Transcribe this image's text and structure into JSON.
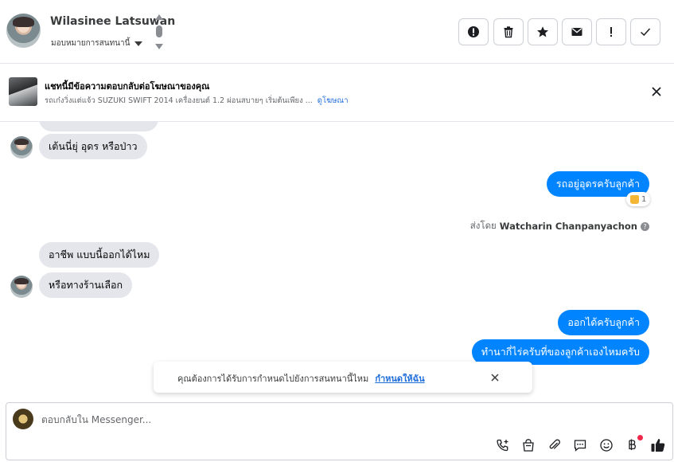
{
  "header": {
    "name": "Wilasinee Latsuwan",
    "assign_label": "มอบหมายการสนทนานี้"
  },
  "toolbar": {
    "buttons": [
      "report-icon",
      "trash-icon",
      "star-icon",
      "mail-icon",
      "exclamation-icon",
      "check-icon"
    ]
  },
  "ad": {
    "title": "แชทนี้มีข้อความตอบกลับต่อโฆษณาของคุณ",
    "description": "รถเก๋งวิ่งแต่แจ้ว SUZUKI SWIFT 2014 เครื่องยนต์ 1.2 ผ่อนสบายๆ เริ่มต้นเพียง ...",
    "link": "ดูโฆษณา"
  },
  "messages": {
    "in1": "เต้นนี่ยุ่ อุดร หรือป่าว",
    "out1": "รถอยู่อุดรครับลูกค้า",
    "reaction_count": "1",
    "sent_by_prefix": "ส่งโดย",
    "sent_by_name": "Watcharin Chanpanyachon",
    "sent_by_help": "?",
    "in2": "อาชีพ แบบนี้ออกได้ไหม",
    "in3": "หรือทางร้านเลือก",
    "out2": "ออกได้ครับลูกค้า",
    "out3": "ทำนากี่ไร่ครับที่ของลูกค้าเองไหมครับ"
  },
  "prompt": {
    "text": "คุณต้องการได้รับการกำหนดไปยังการสนทนานี้ไหม",
    "link": "กำหนดให้ฉัน"
  },
  "composer": {
    "placeholder": "ตอบกลับใน Messenger..."
  },
  "colors": {
    "outgoing": "#0084ff",
    "incoming": "#e4e6eb",
    "link": "#216fdb",
    "notification": "#f02849"
  }
}
